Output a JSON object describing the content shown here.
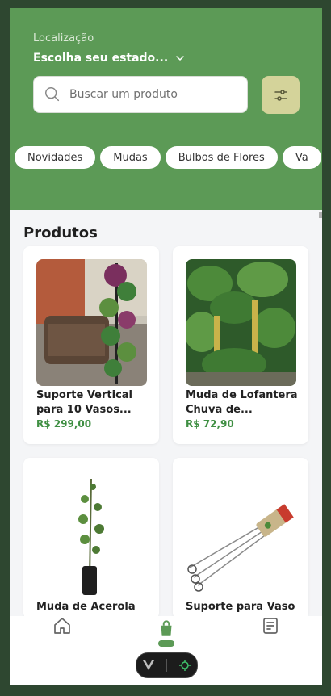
{
  "header": {
    "location_label": "Localização",
    "location_value": "Escolha seu estado...",
    "search_placeholder": "Buscar um produto"
  },
  "categories": [
    "Novidades",
    "Mudas",
    "Bulbos de Flores",
    "Va"
  ],
  "section_title": "Produtos",
  "products": [
    {
      "name_line1": "Suporte Vertical",
      "name_line2": "para 10 Vasos...",
      "price": "R$ 299,00"
    },
    {
      "name_line1": "Muda de Lofantera",
      "name_line2": "Chuva de...",
      "price": "R$ 72,90"
    },
    {
      "name_line1": "Muda de Acerola",
      "name_line2": "",
      "price": ""
    },
    {
      "name_line1": "Suporte para Vaso",
      "name_line2": "",
      "price": ""
    }
  ],
  "colors": {
    "header_green": "#5c9a56",
    "price_green": "#3f8f43",
    "filter_button": "#d4d39a",
    "active_nav": "#5c9a56"
  },
  "icons": {
    "search": "search-icon",
    "filter": "sliders-icon",
    "chevron": "chevron-down-icon",
    "home": "home-icon",
    "bag": "shopping-bag-icon",
    "orders": "receipt-icon"
  }
}
